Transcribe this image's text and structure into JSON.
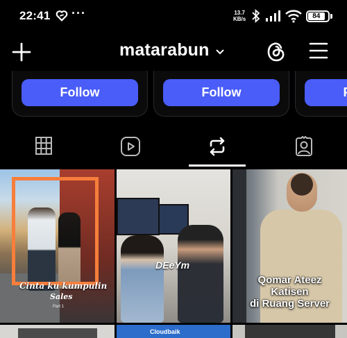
{
  "status_bar": {
    "time": "22:41",
    "net_speed_value": "13.7",
    "net_speed_unit": "KB/s",
    "battery": "84",
    "dots": "···"
  },
  "app_bar": {
    "username": "matarabun",
    "icons": [
      "plus-icon",
      "chevron-down-icon",
      "threads-icon",
      "menu-icon"
    ]
  },
  "suggestions": {
    "follow_label": "Follow"
  },
  "tabs": {
    "items": [
      "grid-icon",
      "reels-icon",
      "reposts-icon",
      "tagged-icon"
    ],
    "active": 2
  },
  "grid": {
    "tile1": {
      "caption_line1": "Cinta ku kumpulin",
      "caption_line2": "Sales",
      "part": "Part 1"
    },
    "tile2": {
      "caption": "DEeYm"
    },
    "tile3": {
      "caption_line1": "Qomar Ateez",
      "caption_line2": "Katisen",
      "caption_line3": "di Ruang Server"
    },
    "tile5": {
      "label": "Cloudbaik"
    }
  },
  "colors": {
    "follow_button": "#4a5df9",
    "frame_orange": "#f77e3b",
    "background": "#000000"
  }
}
